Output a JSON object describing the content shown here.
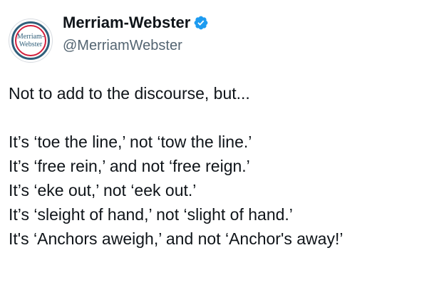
{
  "account": {
    "avatar_text_line1": "Merriam-",
    "avatar_text_line2": "Webster",
    "display_name": "Merriam-Webster",
    "handle": "@MerriamWebster",
    "verified_icon": "verified-badge-icon",
    "verified_color": "#1d9bf0"
  },
  "tweet": {
    "intro": "Not to add to the discourse, but...",
    "lines": [
      "It’s ‘toe the line,’ not ‘tow the line.’",
      "It’s ‘free rein,’ and not ‘free reign.’",
      "It’s ‘eke out,’ not ‘eek out.’",
      "It’s ‘sleight of hand,’ not ‘slight of hand.’",
      "It's ‘Anchors aweigh,’ and not ‘Anchor's away!’"
    ]
  }
}
